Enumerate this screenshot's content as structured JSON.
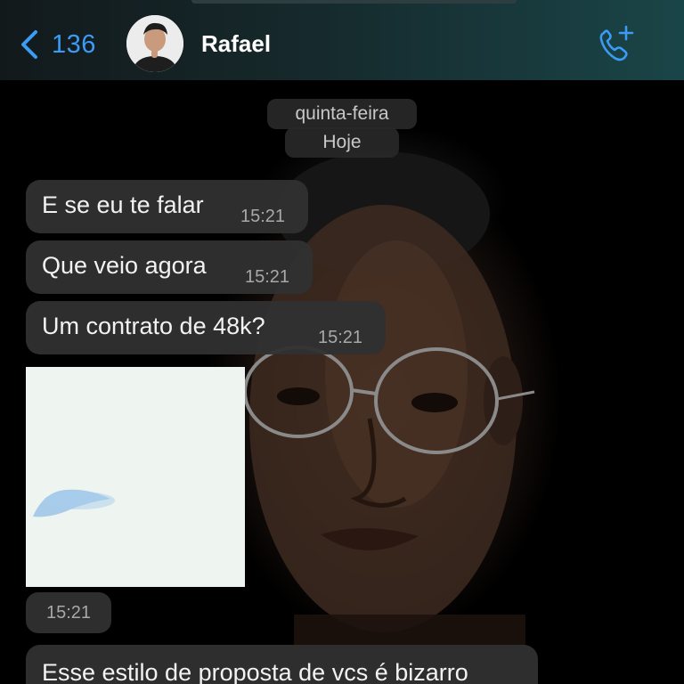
{
  "header": {
    "back_count": "136",
    "contact_name": "Rafael",
    "call_icon": "phone-plus-icon",
    "back_icon": "chevron-left-icon"
  },
  "date_chips": {
    "day": "quinta-feira",
    "today": "Hoje"
  },
  "messages": [
    {
      "text": "E se eu te falar",
      "time": "15:21"
    },
    {
      "text": "Que veio agora",
      "time": "15:21"
    },
    {
      "text": "Um contrato de 48k?",
      "time": "15:21"
    },
    {
      "type": "image",
      "time": "15:21"
    },
    {
      "text": "Esse estilo de proposta de vcs é bizarro"
    }
  ],
  "colors": {
    "accent": "#3b9bf5",
    "bubble": "#303032",
    "header_start": "#12191b",
    "header_end": "#1a4548"
  }
}
